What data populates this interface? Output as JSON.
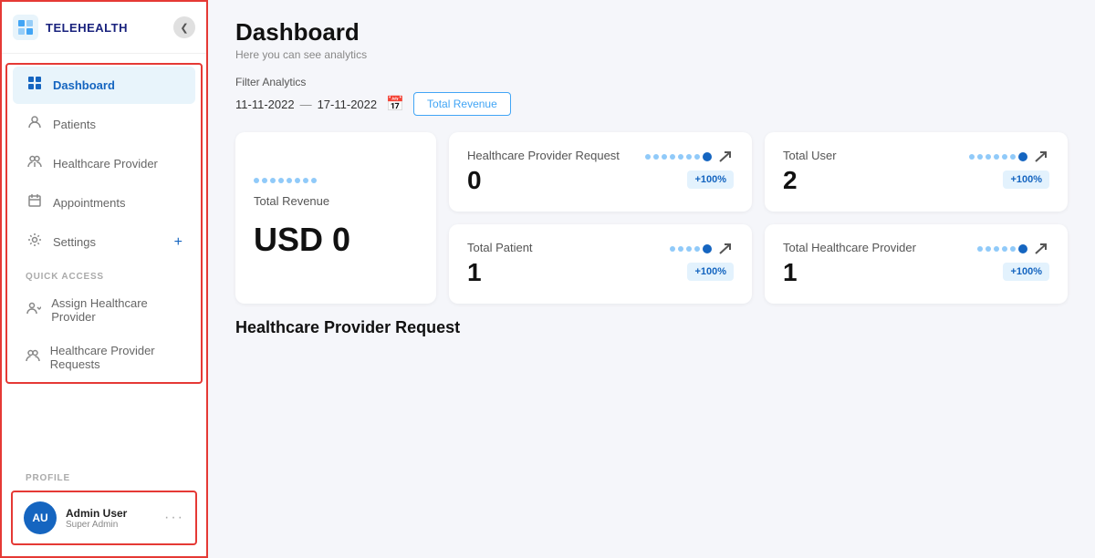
{
  "sidebar": {
    "logo_text": "TELEHEALTH",
    "collapse_icon": "❮",
    "nav_items": [
      {
        "id": "dashboard",
        "label": "Dashboard",
        "icon": "⊞",
        "active": true
      },
      {
        "id": "patients",
        "label": "Patients",
        "icon": "👤"
      },
      {
        "id": "healthcare-provider",
        "label": "Healthcare Provider",
        "icon": "👥"
      },
      {
        "id": "appointments",
        "label": "Appointments",
        "icon": "📅"
      },
      {
        "id": "settings",
        "label": "Settings",
        "icon": "⚙",
        "has_plus": true
      }
    ],
    "quick_access_label": "QUICK ACCESS",
    "quick_access_items": [
      {
        "id": "assign-hp",
        "label": "Assign Healthcare Provider",
        "icon": "👥"
      },
      {
        "id": "hp-requests",
        "label": "Healthcare Provider Requests",
        "icon": "👥"
      }
    ],
    "profile_label": "PROFILE",
    "profile": {
      "initials": "AU",
      "name": "Admin User",
      "role": "Super Admin",
      "dots": "···"
    }
  },
  "main": {
    "page_title": "Dashboard",
    "page_subtitle": "Here you can see analytics",
    "filter": {
      "label": "Filter Analytics",
      "date_from": "11-11-2022",
      "date_dash": "—",
      "date_to": "17-11-2022",
      "calendar_icon": "📅",
      "button_label": "Total Revenue"
    },
    "stats": [
      {
        "id": "hp-request",
        "label": "Healthcare Provider Request",
        "value": "0",
        "badge": "+100%",
        "trend": "↗"
      },
      {
        "id": "total-user",
        "label": "Total User",
        "value": "2",
        "badge": "+100%",
        "trend": "↗"
      },
      {
        "id": "total-patient",
        "label": "Total Patient",
        "value": "1",
        "badge": "+100%",
        "trend": "↗"
      },
      {
        "id": "total-hp",
        "label": "Total Healthcare Provider",
        "value": "1",
        "badge": "+100%",
        "trend": "↗"
      }
    ],
    "revenue": {
      "label": "Total Revenue",
      "value": "USD 0"
    },
    "bottom_section_label": "Healthcare Provider Request"
  }
}
